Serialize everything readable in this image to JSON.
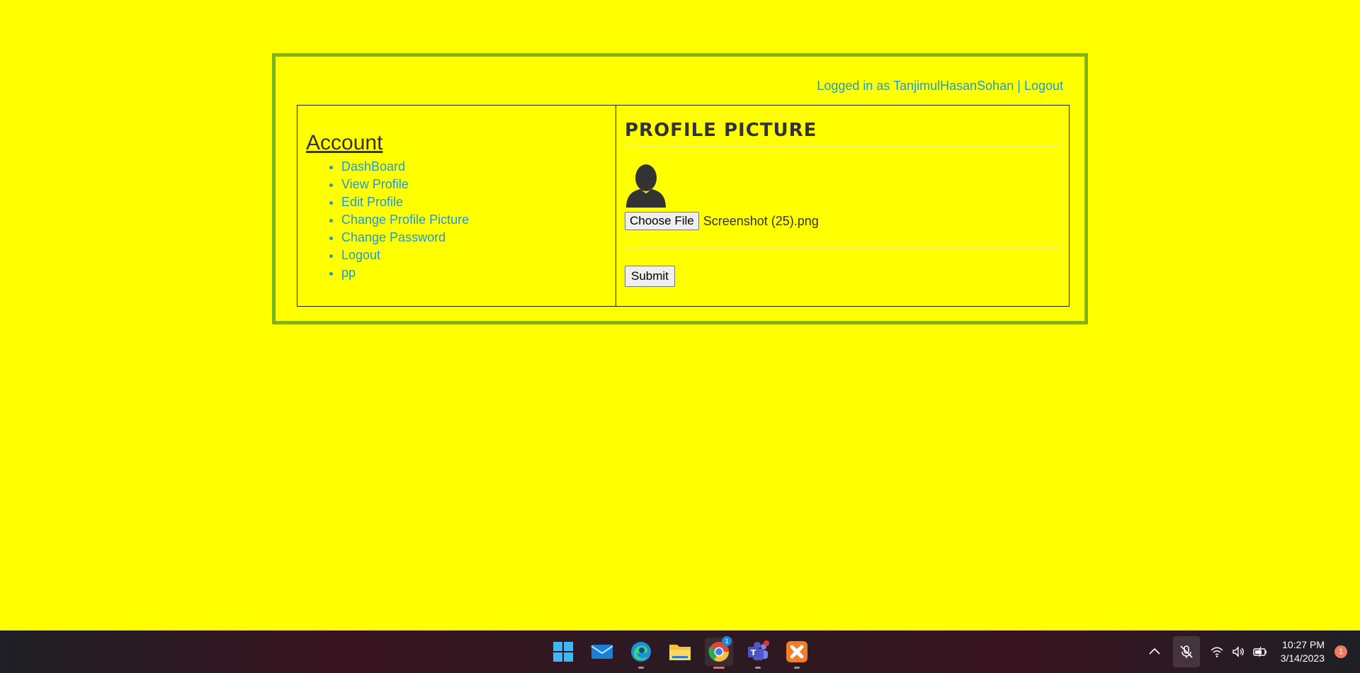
{
  "header": {
    "logged_in_prefix": "Logged in as",
    "username": "TanjimulHasanSohan",
    "separator": "|",
    "logout_label": "Logout"
  },
  "sidebar": {
    "title": "Account",
    "items": [
      {
        "label": "DashBoard"
      },
      {
        "label": "View Profile"
      },
      {
        "label": "Edit Profile"
      },
      {
        "label": "Change Profile Picture"
      },
      {
        "label": "Change Password"
      },
      {
        "label": "Logout"
      },
      {
        "label": "pp"
      }
    ]
  },
  "content": {
    "title": "PROFILE PICTURE",
    "choose_file_label": "Choose File",
    "file_name": "Screenshot (25).png",
    "submit_label": "Submit"
  },
  "taskbar": {
    "apps": [
      {
        "name": "start-icon"
      },
      {
        "name": "mail-icon"
      },
      {
        "name": "edge-icon"
      },
      {
        "name": "file-explorer-icon"
      },
      {
        "name": "chrome-icon"
      },
      {
        "name": "teams-icon"
      },
      {
        "name": "xampp-icon"
      }
    ],
    "chrome_badge": "1",
    "time": "10:27 PM",
    "date": "3/14/2023",
    "notification_count": "1"
  },
  "colors": {
    "page_background": "#ffff00",
    "frame_border": "#7cb518",
    "link": "#1f9ad6"
  }
}
